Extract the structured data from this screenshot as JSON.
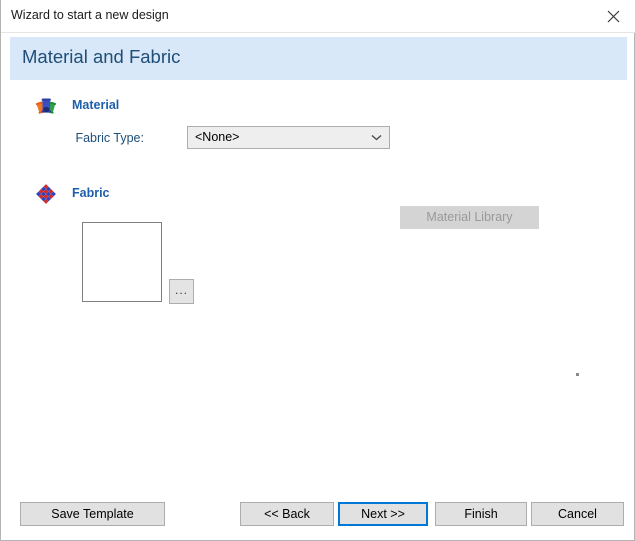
{
  "window": {
    "title": "Wizard to start a new design",
    "close_icon": "close-icon"
  },
  "header": {
    "title": "Material and Fabric",
    "background": "#d8e8f8",
    "text_color": "#1f4e79"
  },
  "sections": {
    "material": {
      "icon": "spools-icon",
      "label": "Material",
      "field_label": "Fabric Type:",
      "dropdown": {
        "value": "<None>",
        "icon": "chevron-down-icon"
      },
      "library_button": {
        "label": "Material Library",
        "disabled": true
      }
    },
    "fabric": {
      "icon": "weave-pattern-icon",
      "label": "Fabric",
      "preview": "",
      "browse_button_label": "..."
    }
  },
  "footer": {
    "save_template": "Save Template",
    "back": "<< Back",
    "next": "Next >>",
    "finish": "Finish",
    "cancel": "Cancel",
    "focus_color": "#0078d7"
  }
}
